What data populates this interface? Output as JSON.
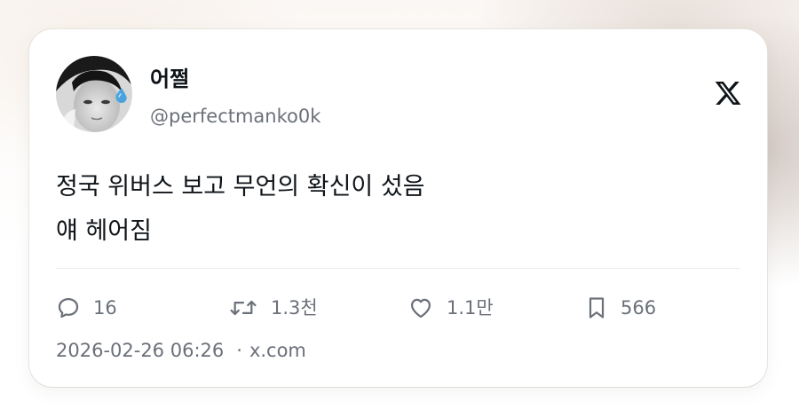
{
  "tweet": {
    "display_name": "어쩔",
    "handle": "@perfectmanko0k",
    "text_lines": [
      "정국 위버스 보고 무언의 확신이 섰음",
      "얘 헤어짐"
    ],
    "timestamp": "2026-02-26 06:26",
    "separator": "·",
    "source": "x.com"
  },
  "metrics": {
    "replies": "16",
    "retweets": "1.3천",
    "likes": "1.1만",
    "bookmarks": "566"
  },
  "icons": {
    "brand": "x-logo-icon",
    "reply": "reply-icon",
    "retweet": "retweet-icon",
    "like": "heart-icon",
    "bookmark": "bookmark-icon"
  },
  "colors": {
    "text_primary": "#0f1419",
    "text_secondary": "#6b7079",
    "card_background": "#ffffff",
    "divider": "#ebebeb"
  }
}
